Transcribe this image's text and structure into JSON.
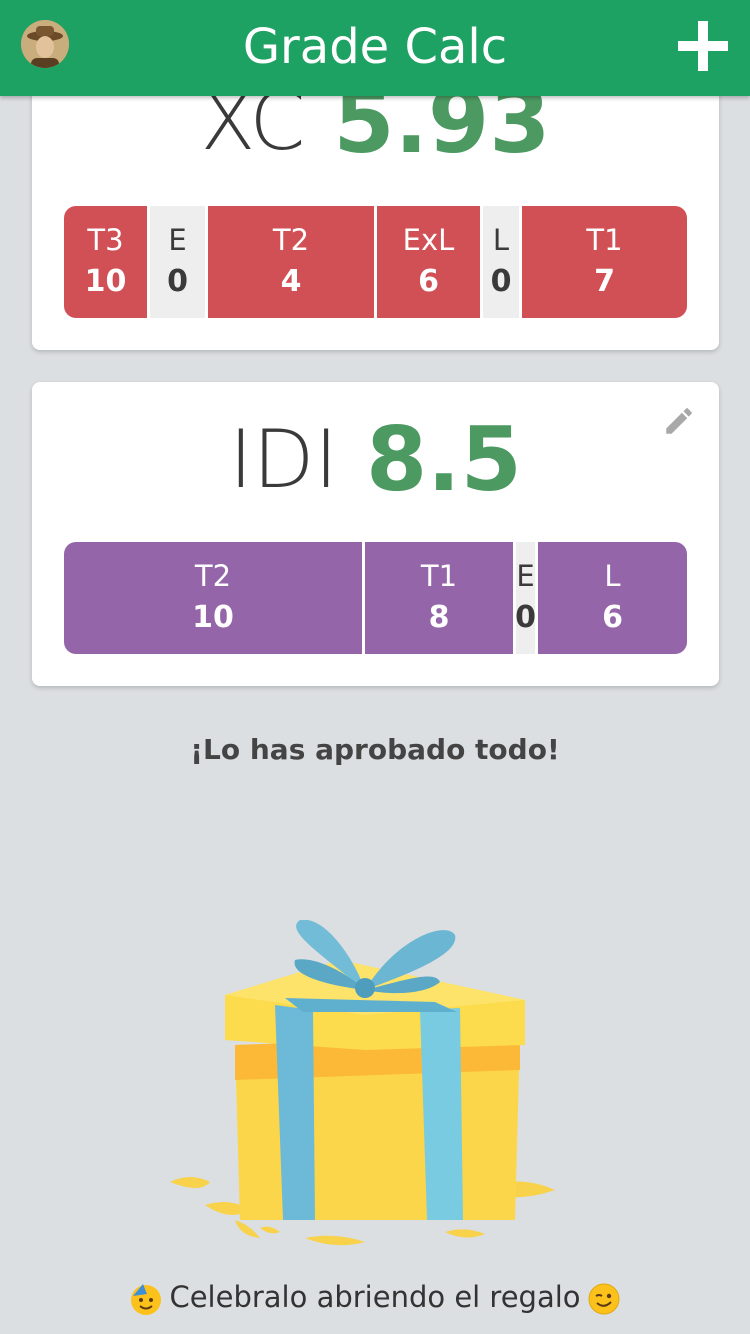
{
  "header": {
    "title": "Grade Calc",
    "avatar_icon": "user-avatar",
    "add_icon": "plus-icon"
  },
  "colors": {
    "header": "#1ea263",
    "grade": "#4c9a61",
    "xc": "#d05055",
    "idi": "#9465a9",
    "zero": "#eeeeee"
  },
  "subjects": [
    {
      "name": "XC",
      "grade": "5.93",
      "segments": [
        {
          "label": "T3",
          "value": "10"
        },
        {
          "label": "E",
          "value": "0"
        },
        {
          "label": "T2",
          "value": "4"
        },
        {
          "label": "ExL",
          "value": "6"
        },
        {
          "label": "L",
          "value": "0"
        },
        {
          "label": "T1",
          "value": "7"
        }
      ]
    },
    {
      "name": "IDI",
      "grade": "8.5",
      "segments": [
        {
          "label": "T2",
          "value": "10"
        },
        {
          "label": "T1",
          "value": "8"
        },
        {
          "label": "E",
          "value": "0"
        },
        {
          "label": "L",
          "value": "6"
        }
      ]
    }
  ],
  "message": "¡Lo has aprobado todo!",
  "footer": {
    "text": "Celebralo abriendo el regalo",
    "emoji_left": "party-face-icon",
    "emoji_right": "wink-face-icon"
  }
}
